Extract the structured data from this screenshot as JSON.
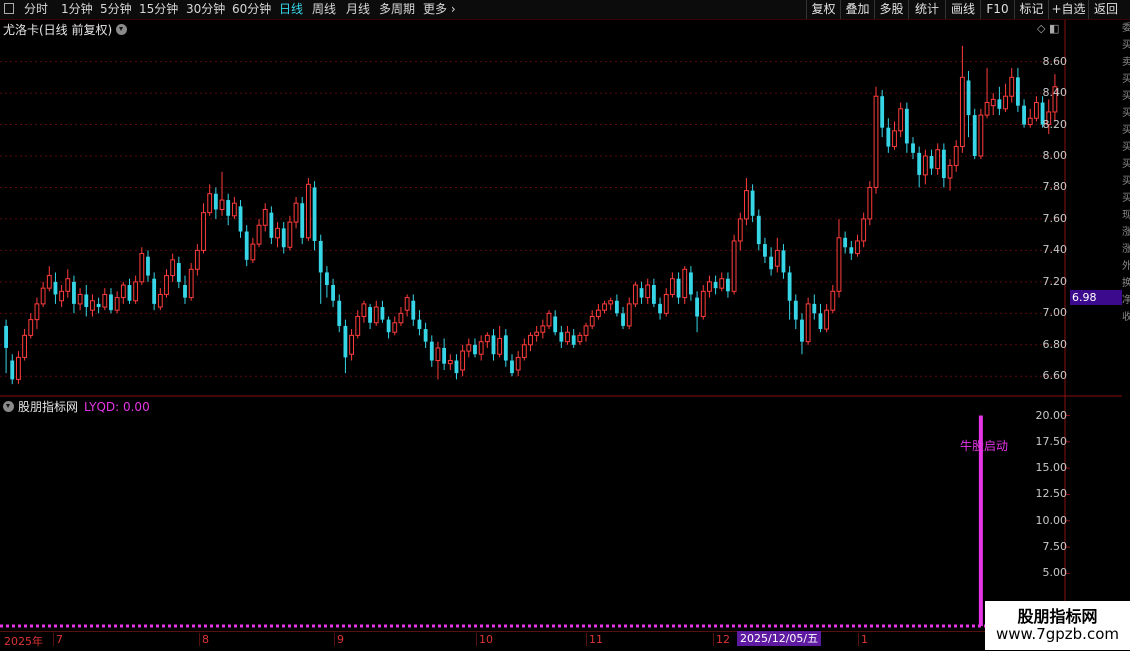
{
  "toolbar": {
    "periods": [
      "分时",
      "1分钟",
      "5分钟",
      "15分钟",
      "30分钟",
      "60分钟",
      "日线",
      "周线",
      "月线",
      "多周期",
      "更多 ›"
    ],
    "active_period": "日线",
    "actions": [
      "复权",
      "叠加",
      "多股",
      "统计",
      "画线",
      "F10",
      "标记",
      "+自选",
      "返回"
    ]
  },
  "main_pane": {
    "title": "尤洛卡(日线 前复权)",
    "current_price_tag": "6.98",
    "y_ticks": [
      "8.60",
      "8.40",
      "8.20",
      "8.00",
      "7.80",
      "7.60",
      "7.40",
      "7.20",
      "7.00",
      "6.80",
      "6.60"
    ]
  },
  "sub_pane": {
    "name": "股朋指标网",
    "indicator": "LYQD: 0.00",
    "signal_text": "牛股启动",
    "y_ticks": [
      "20.00",
      "17.50",
      "15.00",
      "12.50",
      "10.00",
      "7.50",
      "5.00"
    ]
  },
  "date_axis": {
    "labels": [
      "2025年",
      "7",
      "8",
      "9",
      "10",
      "11",
      "12",
      "1"
    ],
    "cursor_label": "2025/12/05/五"
  },
  "right_strip_chars": [
    "委",
    "买",
    "卖",
    "买",
    "买",
    "买",
    "买",
    "买",
    "买",
    "买",
    "买",
    "现",
    "涨",
    "涨",
    "外",
    "换",
    "净",
    "收"
  ],
  "watermark": {
    "line1": "股朋指标网",
    "line2": "www.7gpzb.com"
  },
  "colors": {
    "up": "#ff3c3c",
    "down": "#36d6e7",
    "signal": "#e535e5",
    "grid": "#5a0a0a",
    "axis": "#8a1010"
  },
  "chart_data": {
    "type": "candlestick",
    "ylim": [
      6.5,
      8.75
    ],
    "candles": [
      [
        6.92,
        6.78,
        6.96,
        6.62
      ],
      [
        6.7,
        6.58,
        6.74,
        6.55
      ],
      [
        6.58,
        6.72,
        6.76,
        6.55
      ],
      [
        6.72,
        6.86,
        6.9,
        6.7
      ],
      [
        6.86,
        6.96,
        7.0,
        6.84
      ],
      [
        6.96,
        7.06,
        7.1,
        6.9
      ],
      [
        7.06,
        7.16,
        7.2,
        7.04
      ],
      [
        7.16,
        7.24,
        7.3,
        7.14
      ],
      [
        7.2,
        7.12,
        7.26,
        7.06
      ],
      [
        7.08,
        7.14,
        7.18,
        7.04
      ],
      [
        7.14,
        7.22,
        7.28,
        7.1
      ],
      [
        7.2,
        7.06,
        7.24,
        7.0
      ],
      [
        7.06,
        7.12,
        7.16,
        7.02
      ],
      [
        7.12,
        7.04,
        7.18,
        6.98
      ],
      [
        7.02,
        7.08,
        7.12,
        6.98
      ],
      [
        7.06,
        7.04,
        7.1,
        7.0
      ],
      [
        7.04,
        7.12,
        7.16,
        7.02
      ],
      [
        7.12,
        7.02,
        7.16,
        7.0
      ],
      [
        7.02,
        7.1,
        7.14,
        7.0
      ],
      [
        7.1,
        7.18,
        7.2,
        7.06
      ],
      [
        7.18,
        7.08,
        7.22,
        7.06
      ],
      [
        7.08,
        7.2,
        7.24,
        7.06
      ],
      [
        7.2,
        7.38,
        7.42,
        7.18
      ],
      [
        7.36,
        7.24,
        7.4,
        7.2
      ],
      [
        7.22,
        7.06,
        7.26,
        7.02
      ],
      [
        7.04,
        7.12,
        7.16,
        7.02
      ],
      [
        7.12,
        7.24,
        7.28,
        7.1
      ],
      [
        7.24,
        7.34,
        7.38,
        7.2
      ],
      [
        7.32,
        7.2,
        7.36,
        7.16
      ],
      [
        7.18,
        7.1,
        7.24,
        7.06
      ],
      [
        7.1,
        7.28,
        7.32,
        7.08
      ],
      [
        7.28,
        7.4,
        7.44,
        7.24
      ],
      [
        7.4,
        7.64,
        7.7,
        7.38
      ],
      [
        7.64,
        7.76,
        7.82,
        7.62
      ],
      [
        7.76,
        7.66,
        7.8,
        7.6
      ],
      [
        7.66,
        7.72,
        7.9,
        7.62
      ],
      [
        7.72,
        7.62,
        7.76,
        7.56
      ],
      [
        7.62,
        7.7,
        7.74,
        7.6
      ],
      [
        7.68,
        7.52,
        7.72,
        7.48
      ],
      [
        7.52,
        7.34,
        7.56,
        7.3
      ],
      [
        7.34,
        7.44,
        7.48,
        7.32
      ],
      [
        7.44,
        7.56,
        7.6,
        7.42
      ],
      [
        7.56,
        7.66,
        7.7,
        7.52
      ],
      [
        7.64,
        7.48,
        7.68,
        7.44
      ],
      [
        7.48,
        7.54,
        7.58,
        7.42
      ],
      [
        7.54,
        7.42,
        7.58,
        7.38
      ],
      [
        7.42,
        7.58,
        7.62,
        7.4
      ],
      [
        7.58,
        7.7,
        7.74,
        7.54
      ],
      [
        7.7,
        7.48,
        7.74,
        7.44
      ],
      [
        7.48,
        7.82,
        7.86,
        7.46
      ],
      [
        7.8,
        7.46,
        7.84,
        7.4
      ],
      [
        7.46,
        7.26,
        7.5,
        7.06
      ],
      [
        7.26,
        7.18,
        7.3,
        7.1
      ],
      [
        7.18,
        7.08,
        7.22,
        7.04
      ],
      [
        7.08,
        6.92,
        7.12,
        6.88
      ],
      [
        6.92,
        6.72,
        6.96,
        6.62
      ],
      [
        6.74,
        6.86,
        6.9,
        6.7
      ],
      [
        6.86,
        6.98,
        7.02,
        6.84
      ],
      [
        6.98,
        7.06,
        7.08,
        6.94
      ],
      [
        7.04,
        6.94,
        7.06,
        6.9
      ],
      [
        6.94,
        7.04,
        7.08,
        6.92
      ],
      [
        7.04,
        6.96,
        7.08,
        6.94
      ],
      [
        6.96,
        6.88,
        6.98,
        6.84
      ],
      [
        6.88,
        6.94,
        6.98,
        6.86
      ],
      [
        6.94,
        7.0,
        7.04,
        6.92
      ],
      [
        7.02,
        7.1,
        7.12,
        6.98
      ],
      [
        7.08,
        6.96,
        7.12,
        6.92
      ],
      [
        6.96,
        6.9,
        7.02,
        6.86
      ],
      [
        6.9,
        6.82,
        6.94,
        6.78
      ],
      [
        6.82,
        6.7,
        6.86,
        6.66
      ],
      [
        6.7,
        6.78,
        6.82,
        6.58
      ],
      [
        6.78,
        6.68,
        6.84,
        6.64
      ],
      [
        6.68,
        6.7,
        6.74,
        6.64
      ],
      [
        6.7,
        6.62,
        6.74,
        6.58
      ],
      [
        6.64,
        6.76,
        6.8,
        6.6
      ],
      [
        6.76,
        6.8,
        6.84,
        6.72
      ],
      [
        6.8,
        6.74,
        6.84,
        6.72
      ],
      [
        6.74,
        6.82,
        6.86,
        6.7
      ],
      [
        6.82,
        6.86,
        6.88,
        6.78
      ],
      [
        6.86,
        6.74,
        6.9,
        6.7
      ],
      [
        6.74,
        6.84,
        6.92,
        6.72
      ],
      [
        6.86,
        6.7,
        6.9,
        6.66
      ],
      [
        6.7,
        6.62,
        6.74,
        6.6
      ],
      [
        6.64,
        6.72,
        6.76,
        6.6
      ],
      [
        6.72,
        6.8,
        6.84,
        6.7
      ],
      [
        6.8,
        6.86,
        6.88,
        6.76
      ],
      [
        6.86,
        6.88,
        6.92,
        6.82
      ],
      [
        6.88,
        6.92,
        6.96,
        6.84
      ],
      [
        6.92,
        7.0,
        7.02,
        6.9
      ],
      [
        6.98,
        6.88,
        7.02,
        6.86
      ],
      [
        6.88,
        6.82,
        6.92,
        6.78
      ],
      [
        6.82,
        6.88,
        6.92,
        6.8
      ],
      [
        6.86,
        6.8,
        6.9,
        6.78
      ],
      [
        6.82,
        6.86,
        6.88,
        6.8
      ],
      [
        6.86,
        6.92,
        6.94,
        6.82
      ],
      [
        6.92,
        6.98,
        7.02,
        6.9
      ],
      [
        6.98,
        7.02,
        7.06,
        6.96
      ],
      [
        7.02,
        7.06,
        7.08,
        7.0
      ],
      [
        7.06,
        7.08,
        7.1,
        7.02
      ],
      [
        7.08,
        7.0,
        7.12,
        6.98
      ],
      [
        7.0,
        6.92,
        7.04,
        6.9
      ],
      [
        6.92,
        7.06,
        7.1,
        6.9
      ],
      [
        7.06,
        7.18,
        7.2,
        7.04
      ],
      [
        7.16,
        7.1,
        7.2,
        7.06
      ],
      [
        7.1,
        7.18,
        7.22,
        7.06
      ],
      [
        7.18,
        7.06,
        7.22,
        7.04
      ],
      [
        7.06,
        7.0,
        7.1,
        6.96
      ],
      [
        7.0,
        7.12,
        7.16,
        6.98
      ],
      [
        7.12,
        7.22,
        7.26,
        7.1
      ],
      [
        7.22,
        7.1,
        7.26,
        7.06
      ],
      [
        7.1,
        7.28,
        7.3,
        7.06
      ],
      [
        7.26,
        7.12,
        7.3,
        7.08
      ],
      [
        7.1,
        6.98,
        7.14,
        6.88
      ],
      [
        6.98,
        7.14,
        7.18,
        6.96
      ],
      [
        7.14,
        7.2,
        7.24,
        7.1
      ],
      [
        7.2,
        7.16,
        7.24,
        7.12
      ],
      [
        7.16,
        7.22,
        7.26,
        7.14
      ],
      [
        7.22,
        7.14,
        7.26,
        7.1
      ],
      [
        7.14,
        7.46,
        7.5,
        7.12
      ],
      [
        7.46,
        7.6,
        7.64,
        7.4
      ],
      [
        7.6,
        7.78,
        7.86,
        7.56
      ],
      [
        7.78,
        7.62,
        7.82,
        7.58
      ],
      [
        7.62,
        7.44,
        7.66,
        7.4
      ],
      [
        7.44,
        7.36,
        7.48,
        7.32
      ],
      [
        7.36,
        7.28,
        7.42,
        7.24
      ],
      [
        7.3,
        7.4,
        7.48,
        7.26
      ],
      [
        7.4,
        7.26,
        7.44,
        7.22
      ],
      [
        7.26,
        7.08,
        7.3,
        6.96
      ],
      [
        7.08,
        6.96,
        7.12,
        6.9
      ],
      [
        6.96,
        6.82,
        7.0,
        6.74
      ],
      [
        6.82,
        7.06,
        7.1,
        6.8
      ],
      [
        7.06,
        7.0,
        7.12,
        6.96
      ],
      [
        7.0,
        6.9,
        7.06,
        6.88
      ],
      [
        6.9,
        7.02,
        7.06,
        6.88
      ],
      [
        7.02,
        7.14,
        7.18,
        7.0
      ],
      [
        7.14,
        7.48,
        7.6,
        7.1
      ],
      [
        7.48,
        7.42,
        7.52,
        7.38
      ],
      [
        7.42,
        7.38,
        7.46,
        7.34
      ],
      [
        7.38,
        7.46,
        7.5,
        7.36
      ],
      [
        7.46,
        7.6,
        7.64,
        7.42
      ],
      [
        7.6,
        7.8,
        7.84,
        7.56
      ],
      [
        7.8,
        8.38,
        8.44,
        7.76
      ],
      [
        8.38,
        8.18,
        8.42,
        8.12
      ],
      [
        8.18,
        8.06,
        8.24,
        8.02
      ],
      [
        8.06,
        8.16,
        8.22,
        8.04
      ],
      [
        8.16,
        8.3,
        8.34,
        8.12
      ],
      [
        8.3,
        8.08,
        8.34,
        8.02
      ],
      [
        8.08,
        8.02,
        8.12,
        7.98
      ],
      [
        8.02,
        7.88,
        8.06,
        7.8
      ],
      [
        7.88,
        8.0,
        8.04,
        7.82
      ],
      [
        8.0,
        7.92,
        8.04,
        7.88
      ],
      [
        7.92,
        8.04,
        8.08,
        7.88
      ],
      [
        8.04,
        7.86,
        8.08,
        7.8
      ],
      [
        7.86,
        7.94,
        7.98,
        7.78
      ],
      [
        7.94,
        8.06,
        8.1,
        7.9
      ],
      [
        8.06,
        8.5,
        8.7,
        8.02
      ],
      [
        8.48,
        8.26,
        8.54,
        8.12
      ],
      [
        8.26,
        8.0,
        8.3,
        7.98
      ],
      [
        8.0,
        8.26,
        8.3,
        7.98
      ],
      [
        8.26,
        8.34,
        8.56,
        8.24
      ],
      [
        8.32,
        8.36,
        8.4,
        8.26
      ],
      [
        8.36,
        8.3,
        8.44,
        8.26
      ],
      [
        8.3,
        8.38,
        8.46,
        8.28
      ],
      [
        8.38,
        8.5,
        8.56,
        8.34
      ],
      [
        8.5,
        8.32,
        8.56,
        8.28
      ],
      [
        8.32,
        8.2,
        8.36,
        8.18
      ],
      [
        8.2,
        8.24,
        8.3,
        8.18
      ],
      [
        8.24,
        8.34,
        8.38,
        8.22
      ],
      [
        8.34,
        8.2,
        8.38,
        8.18
      ],
      [
        8.2,
        8.28,
        8.36,
        8.14
      ],
      [
        8.28,
        8.44,
        8.52,
        8.22
      ]
    ],
    "signal": {
      "index": 158,
      "value": 20
    }
  }
}
